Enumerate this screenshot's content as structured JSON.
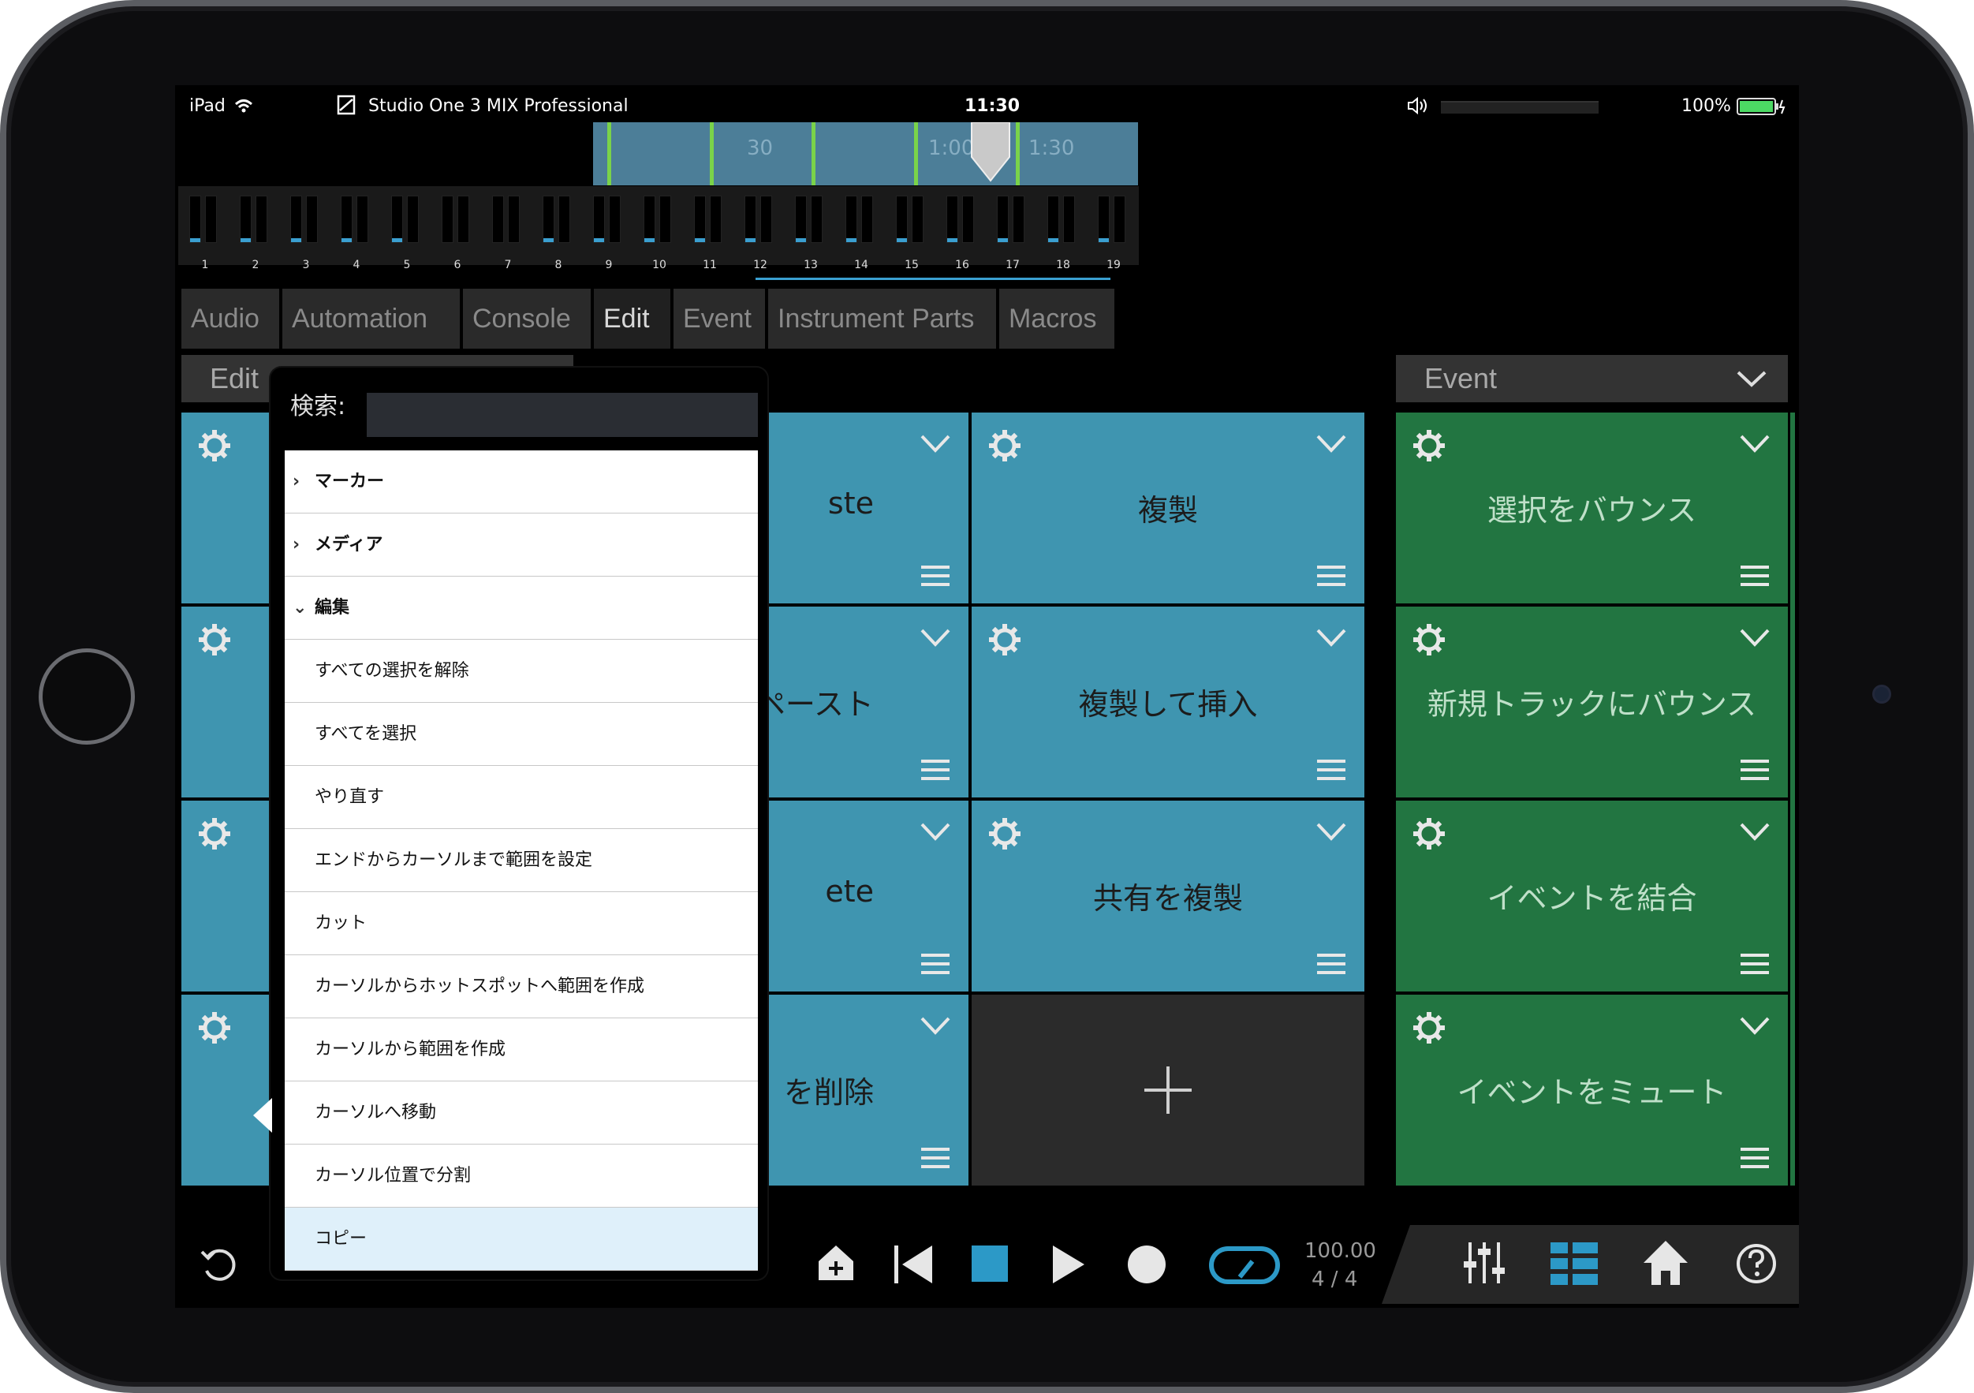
{
  "status_bar": {
    "device": "iPad",
    "app_title": "Studio One 3 MIX Professional",
    "time": "11:30",
    "battery": "100%"
  },
  "overview": {
    "ticks": [
      "30",
      "1:00",
      "1:30"
    ]
  },
  "tracks": [
    "1",
    "2",
    "3",
    "4",
    "5",
    "6",
    "7",
    "8",
    "9",
    "10",
    "11",
    "12",
    "13",
    "14",
    "15",
    "16",
    "17",
    "18",
    "19"
  ],
  "tabs": [
    "Audio",
    "Automation",
    "Console",
    "Edit",
    "Event",
    "Instrument Parts",
    "Macros"
  ],
  "active_tab": "Edit",
  "edit_mode_button": "編集",
  "left_section": {
    "title": "Edit"
  },
  "right_section": {
    "title": "Event"
  },
  "middle_cells": [
    {
      "label": "ste"
    },
    {
      "label": "とペースト"
    },
    {
      "label": "ete"
    },
    {
      "label": "を削除"
    }
  ],
  "edit_cells": [
    {
      "label": "複製"
    },
    {
      "label": "複製して挿入"
    },
    {
      "label": "共有を複製"
    }
  ],
  "event_cells": [
    {
      "label": "選択をバウンス"
    },
    {
      "label": "新規トラックにバウンス"
    },
    {
      "label": "イベントを結合"
    },
    {
      "label": "イベントをミュート"
    }
  ],
  "popover": {
    "search_label": "検索:",
    "search_value": "",
    "items": [
      {
        "label": "マーカー",
        "type": "category",
        "arrow": "›"
      },
      {
        "label": "メディア",
        "type": "category",
        "arrow": "›"
      },
      {
        "label": "編集",
        "type": "category",
        "arrow": "⌄"
      },
      {
        "label": "すべての選択を解除",
        "type": "item"
      },
      {
        "label": "すべてを選択",
        "type": "item"
      },
      {
        "label": "やり直す",
        "type": "item"
      },
      {
        "label": "エンドからカーソルまで範囲を設定",
        "type": "item"
      },
      {
        "label": "カット",
        "type": "item"
      },
      {
        "label": "カーソルからホットスポットへ範囲を作成",
        "type": "item"
      },
      {
        "label": "カーソルから範囲を作成",
        "type": "item"
      },
      {
        "label": "カーソルへ移動",
        "type": "item"
      },
      {
        "label": "カーソル位置で分割",
        "type": "item"
      },
      {
        "label": "コピー",
        "type": "item",
        "selected": true
      }
    ]
  },
  "transport": {
    "tempo": "100.00",
    "signature": "4 / 4"
  },
  "colors": {
    "blue_cell": "#3f95b0",
    "green_cell": "#227541",
    "accent": "#3a9fd0",
    "edit_button": "#3d6c86"
  },
  "icons": [
    "wifi-icon",
    "doc-icon",
    "speaker-icon",
    "battery-icon",
    "gear-icon",
    "chevron-down-icon",
    "menu-icon",
    "plus-icon",
    "undo-icon",
    "marker-add-icon",
    "rewind-start-icon",
    "stop-icon",
    "play-icon",
    "record-icon",
    "loop-icon",
    "mixer-icon",
    "grid-icon",
    "home-icon",
    "help-icon"
  ]
}
